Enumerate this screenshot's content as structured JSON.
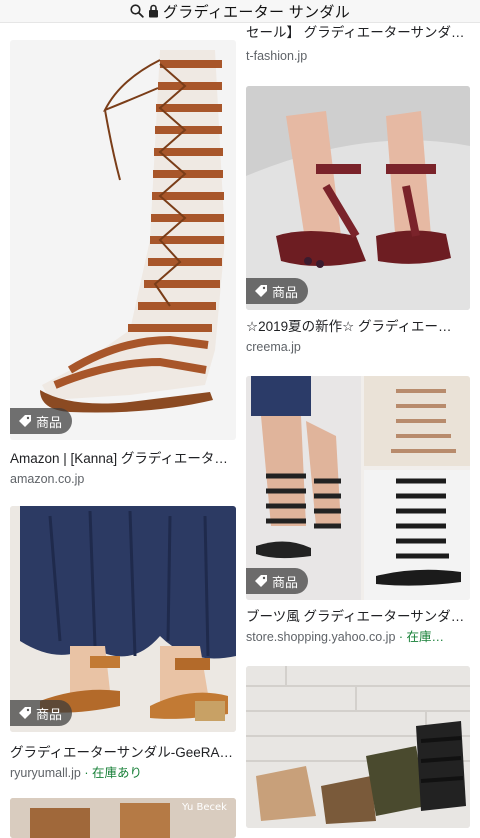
{
  "search": {
    "query": "グラディエーター サンダル"
  },
  "badge_label": "商品",
  "results": {
    "r0": {
      "title": "セール】 グラディエーターサンダ…",
      "source": "t-fashion.jp"
    },
    "r1": {
      "title": "Amazon | [Kanna] グラディエータ…",
      "source": "amazon.co.jp"
    },
    "r2": {
      "title": "☆2019夏の新作☆ グラディエー…",
      "source": "creema.jp"
    },
    "r3": {
      "title": "グラディエーターサンダル-GeeRA…",
      "source": "ryuryumall.jp",
      "stock": "· 在庫あり"
    },
    "r4": {
      "title": "ブーツ風 グラディエーターサンダ…",
      "source": "store.shopping.yahoo.co.jp",
      "stock": "· 在庫…"
    }
  },
  "watermark": "Yu Becek"
}
